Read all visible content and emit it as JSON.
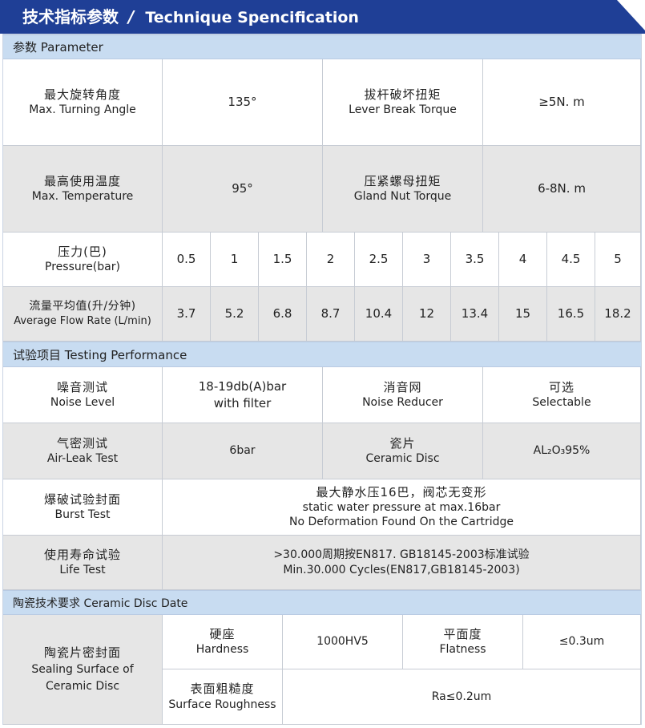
{
  "header": {
    "title_zh": "技术指标参数",
    "separator": "/",
    "title_en": "Technique Spencification",
    "color": "#1f3f96"
  },
  "sections": {
    "parameter": "参数 Parameter",
    "testing": "试验项目 Testing  Performance",
    "ceramic": "陶瓷技术要求 Ceramic  Disc Date"
  },
  "params": {
    "turning_angle": {
      "zh": "最大旋转角度",
      "en": "Max. Turning Angle",
      "value": "135°"
    },
    "lever_break": {
      "zh": "拔杆破坏扭矩",
      "en": "Lever Break  Torque",
      "value": "≥5N. m"
    },
    "temperature": {
      "zh": "最高使用温度",
      "en": "Max. Temperature",
      "value": "95°"
    },
    "gland_nut": {
      "zh": "压紧螺母扭矩",
      "en": "Gland  Nut Torque",
      "value": "6-8N. m"
    },
    "pressure": {
      "zh": "压力(巴)",
      "en": "Pressure(bar)",
      "values": [
        "0.5",
        "1",
        "1.5",
        "2",
        "2.5",
        "3",
        "3.5",
        "4",
        "4.5",
        "5"
      ]
    },
    "flow": {
      "zh": "流量平均值(升/分钟)",
      "en": "Average Flow Rate (L/min)",
      "values": [
        "3.7",
        "5.2",
        "6.8",
        "8.7",
        "10.4",
        "12",
        "13.4",
        "15",
        "16.5",
        "18.2"
      ]
    }
  },
  "testing": {
    "noise": {
      "zh": "噪音测试",
      "en": "Noise Level",
      "value_line1": "18-19db(A)bar",
      "value_line2": "with filter",
      "sub_zh": "消音网",
      "sub_en": "Noise Reducer",
      "sub_value_zh": "可选",
      "sub_value_en": "Selectable"
    },
    "airleak": {
      "zh": "气密测试",
      "en": "Air-Leak Test",
      "value": "6bar",
      "sub_zh": "瓷片",
      "sub_en": "Ceramic Disc",
      "sub_value": "AL₂O₃95%"
    },
    "burst": {
      "zh": "爆破试验封面",
      "en": "Burst Test",
      "line1": "最大静水压16巴，阀芯无变形",
      "line2": "static water pressure at max.16bar",
      "line3": "No Deformation Found On the Cartridge"
    },
    "life": {
      "zh": "使用寿命试验",
      "en": "Life Test",
      "line1": ">30.000周期按EN817. GB18145-2003标准试验",
      "line2": "Min.30.000 Cycles(EN817,GB18145-2003)"
    }
  },
  "ceramic": {
    "sealing": {
      "zh": "陶瓷片密封面",
      "en1": "Sealing Surface of",
      "en2": "Ceramic Disc"
    },
    "hardness": {
      "zh": "硬座",
      "en": "Hardness",
      "value": "1000HV5"
    },
    "flatness": {
      "zh": "平面度",
      "en": "Flatness",
      "value": "≤0.3um"
    },
    "roughness": {
      "zh": "表面粗糙度",
      "en": "Surface Roughness",
      "value": "Ra≤0.2um"
    }
  }
}
